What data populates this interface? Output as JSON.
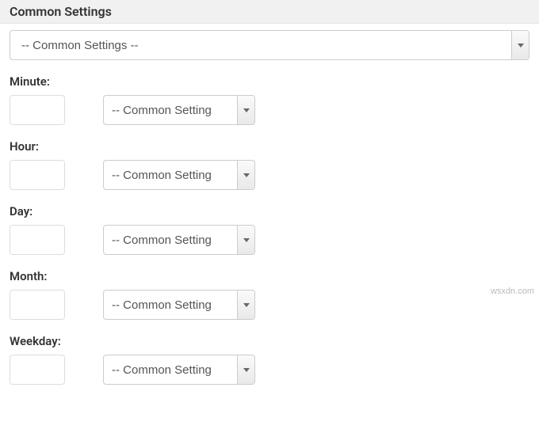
{
  "header": {
    "title": "Common Settings"
  },
  "main_select": {
    "value": "-- Common Settings --"
  },
  "fields": {
    "minute": {
      "label": "Minute:",
      "input_value": "",
      "select_value": "-- Common Setting"
    },
    "hour": {
      "label": "Hour:",
      "input_value": "",
      "select_value": "-- Common Setting"
    },
    "day": {
      "label": "Day:",
      "input_value": "",
      "select_value": "-- Common Setting"
    },
    "month": {
      "label": "Month:",
      "input_value": "",
      "select_value": "-- Common Setting"
    },
    "weekday": {
      "label": "Weekday:",
      "input_value": "",
      "select_value": "-- Common Setting"
    }
  },
  "watermark": "wsxdn.com"
}
